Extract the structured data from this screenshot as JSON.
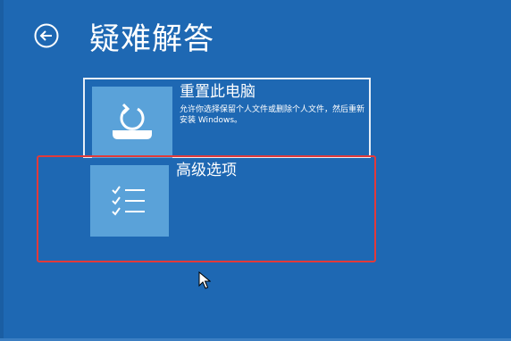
{
  "page": {
    "title": "疑难解答"
  },
  "options": [
    {
      "title": "重置此电脑",
      "description": "允许你选择保留个人文件或删除个人文件，然后重新安装 Windows。",
      "icon": "reset-pc-icon"
    },
    {
      "title": "高级选项",
      "icon": "checklist-icon"
    }
  ],
  "colors": {
    "background": "#1e68b3",
    "tile_icon_bg": "#5aa2d9",
    "focus_border": "#e6eef7",
    "highlight_frame": "#e23a3a"
  }
}
